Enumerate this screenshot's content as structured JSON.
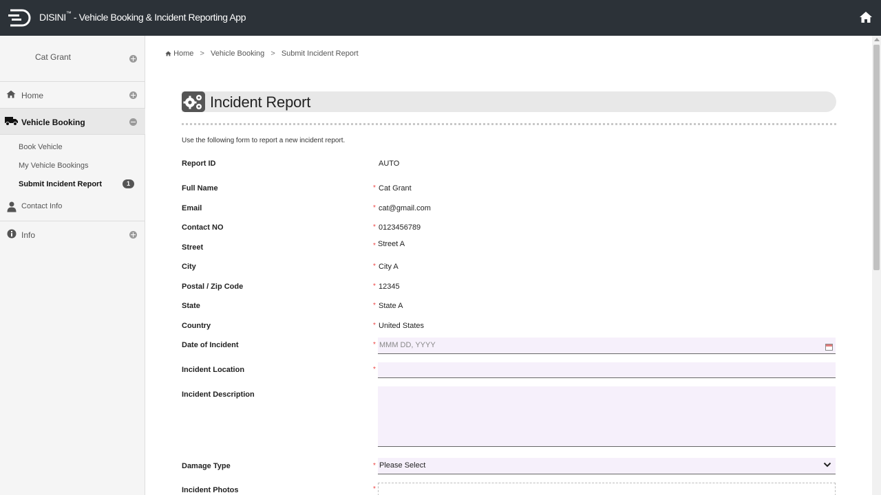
{
  "app": {
    "title_main": "DISINI",
    "title_tm": "™",
    "title_rest": " - Vehicle Booking & Incident Reporting App"
  },
  "sidebar": {
    "user_name": "Cat Grant",
    "items": [
      {
        "label": "Home"
      },
      {
        "label": "Vehicle Booking"
      },
      {
        "label": "Contact Info"
      },
      {
        "label": "Info"
      }
    ],
    "sub_items": [
      {
        "label": "Book Vehicle"
      },
      {
        "label": "My Vehicle Bookings"
      },
      {
        "label": "Submit Incident Report",
        "badge": "1"
      }
    ]
  },
  "breadcrumb": {
    "home": "Home",
    "sep": ">",
    "level1": "Vehicle Booking",
    "level2": "Submit Incident Report"
  },
  "page": {
    "title": "Incident Report",
    "intro": "Use the following form to report a new incident report."
  },
  "form": {
    "required_mark": "*",
    "fields": [
      {
        "label": "Report ID",
        "value": "AUTO"
      },
      {
        "label": "Full Name",
        "value": "Cat Grant"
      },
      {
        "label": "Email",
        "value": "cat@gmail.com"
      },
      {
        "label": "Contact NO",
        "value": "0123456789"
      },
      {
        "label": "Street",
        "value": "Street A"
      },
      {
        "label": "City",
        "value": "City A"
      },
      {
        "label": "Postal / Zip Code",
        "value": "12345"
      },
      {
        "label": "State",
        "value": "State A"
      },
      {
        "label": "Country",
        "value": "United States"
      },
      {
        "label": "Date of Incident",
        "placeholder": "MMM DD, YYYY"
      },
      {
        "label": "Incident Location",
        "value": ""
      },
      {
        "label": "Incident Description",
        "value": ""
      },
      {
        "label": "Damage Type",
        "value": "Please Select"
      },
      {
        "label": "Incident Photos",
        "value": ""
      }
    ]
  },
  "colors": {
    "topbar": "#2c3238",
    "input_bg": "#f6f0fb",
    "required": "#ee4444"
  },
  "icons": {
    "logo": "disini-logo-icon",
    "home": "home-icon",
    "truck": "truck-icon",
    "user": "user-icon",
    "info": "info-icon",
    "gears": "gears-icon",
    "calendar": "calendar-icon",
    "chevron": "chevron-down-icon"
  }
}
